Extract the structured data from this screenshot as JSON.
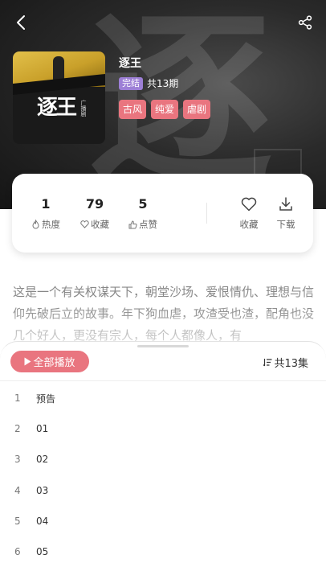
{
  "album": {
    "title": "逐王",
    "status": "完结",
    "episode_count": "共13期",
    "tags": [
      "古风",
      "纯爱",
      "虐剧"
    ],
    "cover_title": "逐王",
    "cover_text": "广播剧"
  },
  "stats": [
    {
      "value": "1",
      "label": "热度",
      "icon": "flame-icon"
    },
    {
      "value": "79",
      "label": "收藏",
      "icon": "heart-icon"
    },
    {
      "value": "5",
      "label": "点赞",
      "icon": "thumb-up-icon"
    }
  ],
  "actions": {
    "favorite_label": "收藏",
    "download_label": "下载"
  },
  "description": "这是一个有关权谋天下，朝堂沙场、爱恨情仇、理想与信仰先破后立的故事。年下狗血虐，攻渣受也渣，配角也没几个好人，更没有宗人，每个人都像人，有",
  "playlist": {
    "play_all_label": "全部播放",
    "total_label": "共13集",
    "episodes": [
      {
        "num": "1",
        "title": "预告"
      },
      {
        "num": "2",
        "title": "01"
      },
      {
        "num": "3",
        "title": "02"
      },
      {
        "num": "4",
        "title": "03"
      },
      {
        "num": "5",
        "title": "04"
      },
      {
        "num": "6",
        "title": "05"
      }
    ]
  },
  "colors": {
    "accent": "#e9757f",
    "status_badge": "#9d7fd6",
    "hero_bg": "#2a2a2a"
  }
}
